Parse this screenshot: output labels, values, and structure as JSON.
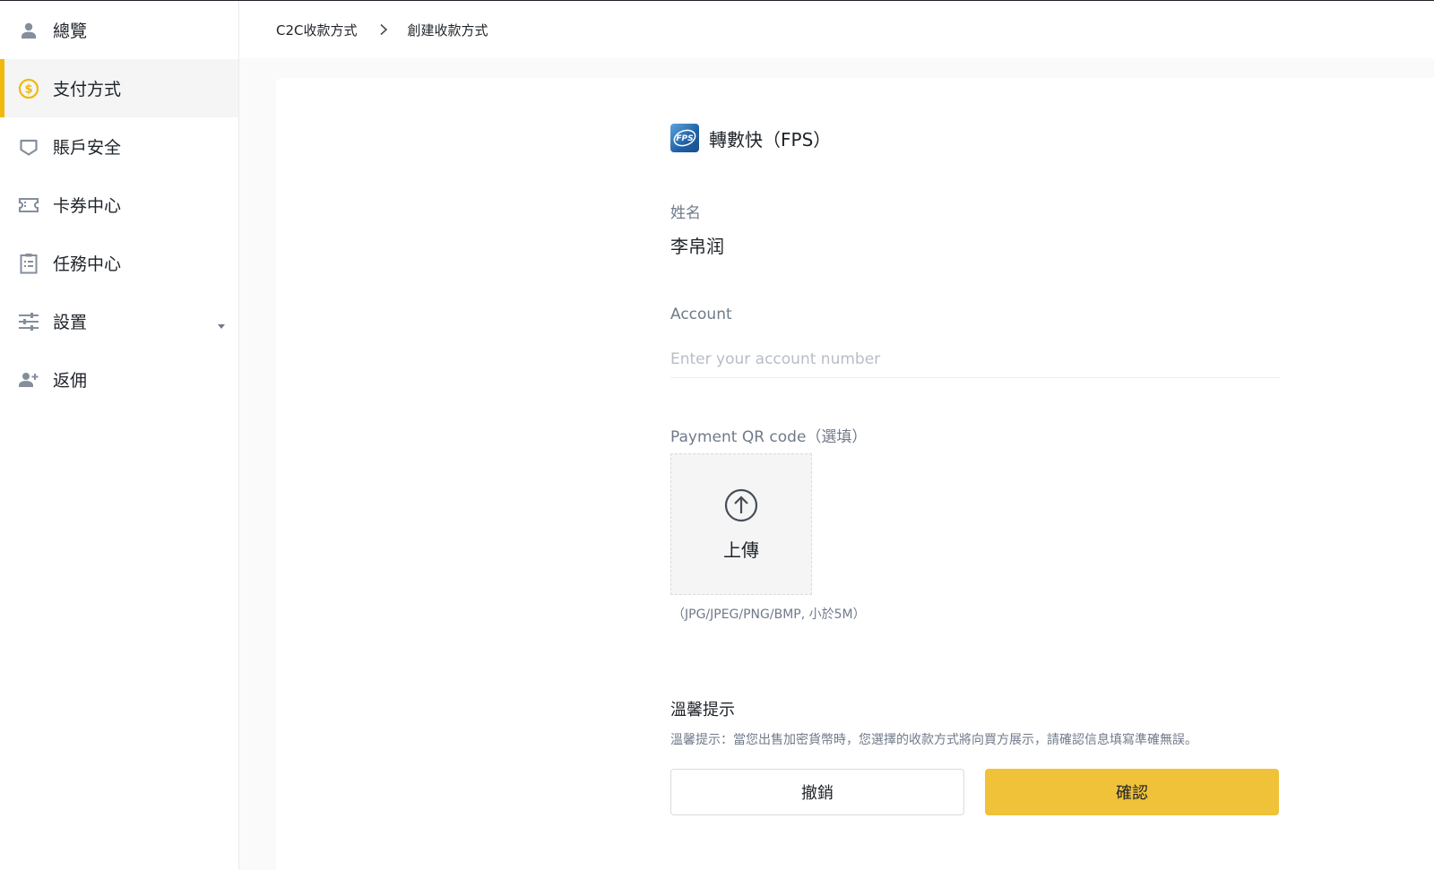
{
  "sidebar": {
    "items": [
      {
        "label": "總覽",
        "icon": "user-icon",
        "active": false
      },
      {
        "label": "支付方式",
        "icon": "dollar-coin-icon",
        "active": true
      },
      {
        "label": "賬戶安全",
        "icon": "shield-icon",
        "active": false
      },
      {
        "label": "卡券中心",
        "icon": "ticket-icon",
        "active": false
      },
      {
        "label": "任務中心",
        "icon": "clipboard-list-icon",
        "active": false
      },
      {
        "label": "設置",
        "icon": "sliders-icon",
        "active": false
      },
      {
        "label": "返佣",
        "icon": "user-plus-icon",
        "active": false
      }
    ]
  },
  "breadcrumb": {
    "parent": "C2C收款方式",
    "current": "創建收款方式"
  },
  "form": {
    "method_name": "轉數快（FPS）",
    "name_label": "姓名",
    "name_value": "李帛润",
    "account_label": "Account",
    "account_placeholder": "Enter your account number",
    "account_value": "",
    "qr_label": "Payment QR code（選填）",
    "upload_label": "上傳",
    "upload_hint": "（JPG/JPEG/PNG/BMP, 小於5M）",
    "tip_title": "溫馨提示",
    "tip_text": "溫馨提示：當您出售加密貨幣時，您選擇的收款方式將向買方展示，請確認信息填寫準確無誤。",
    "cancel_label": "撤銷",
    "confirm_label": "確認"
  },
  "colors": {
    "accent": "#f0b90b",
    "confirm_button": "#f0c23a",
    "muted_text": "#707a8a",
    "text": "#1e2329"
  }
}
